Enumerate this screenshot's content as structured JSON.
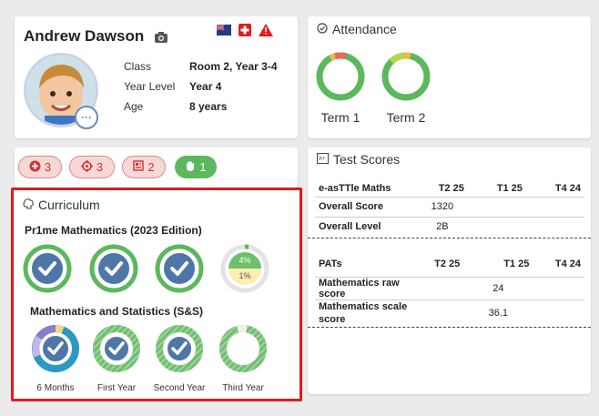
{
  "profile": {
    "name": "Andrew Dawson",
    "fields": [
      {
        "label": "Class",
        "value": "Room 2, Year 3-4"
      },
      {
        "label": "Year Level",
        "value": "Year 4"
      },
      {
        "label": "Age",
        "value": "8 years"
      }
    ],
    "icons": [
      "camera-icon",
      "nz-flag-icon",
      "medical-cross-icon",
      "alert-icon"
    ]
  },
  "attendance": {
    "title": "Attendance",
    "terms": [
      {
        "label": "Term 1"
      },
      {
        "label": "Term 2"
      }
    ]
  },
  "badges": [
    {
      "count": "3",
      "icon": "plus-circle-icon"
    },
    {
      "count": "3",
      "icon": "target-icon"
    },
    {
      "count": "2",
      "icon": "report-icon"
    },
    {
      "count": "1",
      "icon": "hand-icon"
    }
  ],
  "curriculum": {
    "title": "Curriculum",
    "section1": "Pr1me Mathematics (2023 Edition)",
    "progress": {
      "top": "4%",
      "bottom": "1%"
    },
    "section2": "Mathematics and Statistics (S&S)",
    "levels": [
      "6 Months",
      "First Year",
      "Second Year",
      "Third Year"
    ]
  },
  "test_scores": {
    "title": "Test Scores",
    "east": {
      "header": [
        "e-asTTle Maths",
        "T2 25",
        "T1 25",
        "T4 24"
      ],
      "rows": [
        {
          "label": "Overall Score",
          "values": [
            "1320",
            "",
            ""
          ]
        },
        {
          "label": "Overall Level",
          "values": [
            "2B",
            "",
            ""
          ]
        }
      ]
    },
    "pats": {
      "header": [
        "PATs",
        "T2 25",
        "T1 25",
        "T4 24"
      ],
      "rows": [
        {
          "label": "Mathematics raw score",
          "values": [
            "",
            "24",
            ""
          ]
        },
        {
          "label": "Mathematics scale score",
          "values": [
            "",
            "36.1",
            ""
          ]
        }
      ]
    }
  },
  "colors": {
    "green": "#5cb85c",
    "red": "#e21b1b",
    "blue": "#5a7ea8",
    "pill_red": "#f8d7d7",
    "pill_green": "#5cb85c"
  }
}
